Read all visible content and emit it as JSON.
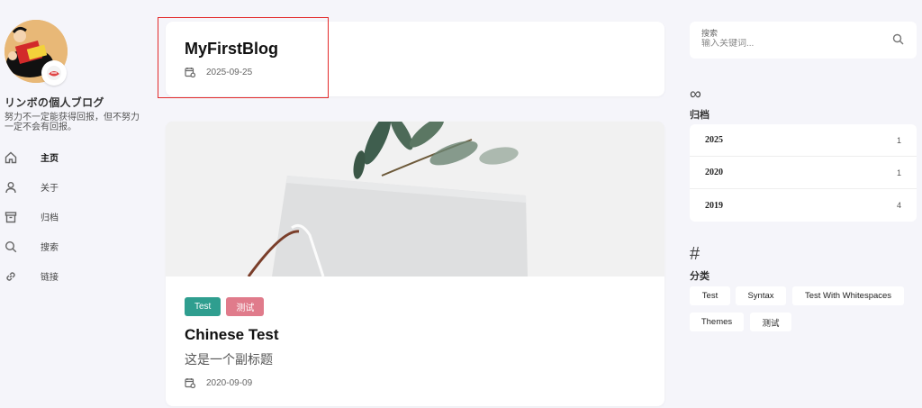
{
  "site": {
    "title": "リンボの個人ブログ",
    "motto": "努力不一定能获得回报，但不努力一定不会有回报。"
  },
  "nav": [
    {
      "label": "主页",
      "icon": "home-icon",
      "active": true
    },
    {
      "label": "关于",
      "icon": "user-icon",
      "active": false
    },
    {
      "label": "归档",
      "icon": "archive-box-icon",
      "active": false
    },
    {
      "label": "搜索",
      "icon": "search-icon",
      "active": false
    },
    {
      "label": "链接",
      "icon": "link-icon",
      "active": false
    }
  ],
  "posts": [
    {
      "title": "MyFirstBlog",
      "date": "2025-09-25"
    },
    {
      "title": "Chinese Test",
      "subtitle": "这是一个副标题",
      "date": "2020-09-09",
      "tags": [
        "Test",
        "测试"
      ]
    }
  ],
  "search": {
    "label": "搜索",
    "placeholder": "输入关键词..."
  },
  "archive": {
    "icon": "∞",
    "title": "归档",
    "years": [
      {
        "year": "2025",
        "count": "1"
      },
      {
        "year": "2020",
        "count": "1"
      },
      {
        "year": "2019",
        "count": "4"
      }
    ]
  },
  "categories": {
    "icon": "#",
    "title": "分类",
    "items": [
      "Test",
      "Syntax",
      "Test With Whitespaces",
      "Themes",
      "测试"
    ]
  },
  "colors": {
    "tag_green": "#2f9e8f",
    "tag_pink": "#e07b8b",
    "highlight": "#e32b2b"
  }
}
